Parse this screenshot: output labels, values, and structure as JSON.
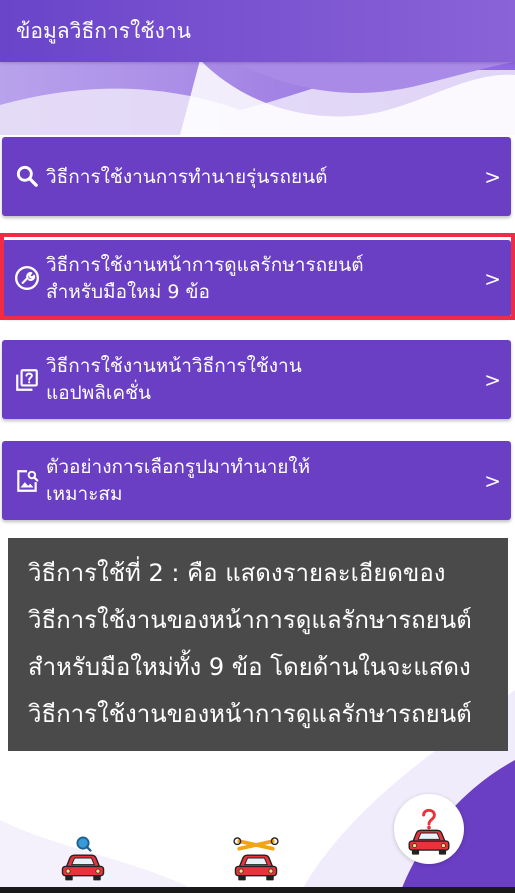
{
  "app_bar": {
    "title": "ข้อมูลวิธีการใช้งาน"
  },
  "menu": [
    {
      "line1": "วิธีการใช้งานการทำนายรุ่นรถยนต์",
      "line2": "",
      "chevron": ">",
      "icon": "search-icon"
    },
    {
      "line1": "วิธีการใช้งานหน้าการดูแลรักษารถยนต์",
      "line2": "สำหรับมือใหม่ 9 ข้อ",
      "chevron": ">",
      "icon": "wrench-circle-icon",
      "selected": true
    },
    {
      "line1": "วิธีการใช้งานหน้าวิธีการใช้งาน",
      "line2": "แอปพลิเคชั่น",
      "chevron": ">",
      "icon": "help-book-icon"
    },
    {
      "line1": "ตัวอย่างการเลือกรูปมาทำนายให้",
      "line2": "เหมาะสม",
      "chevron": ">",
      "icon": "image-search-icon"
    }
  ],
  "caption": {
    "lines": [
      "วิธีการใช้ที่ 2 : คือ แสดงรายละเอียดของ",
      "วิธีการใช้งานของหน้าการดูแลรักษารถยนต์",
      "สำหรับมือใหม่ทั้ง 9 ข้อ โดยด้านในจะแสดง",
      "วิธีการใช้งานของหน้าการดูแลรักษารถยนต์"
    ]
  },
  "bottom_nav": [
    {
      "icon": "car-search-icon"
    },
    {
      "icon": "car-wrench-icon"
    },
    {
      "icon": "car-help-icon",
      "active": true
    }
  ],
  "colors": {
    "primary": "#6a3fc4",
    "app_bar": "#7b53d1",
    "highlight": "#ef2b45",
    "caption_bg": "#4a4a4a",
    "car_red": "#e8333a",
    "help_red": "#e8333a",
    "tool_orange": "#f2a316",
    "search_blue": "#3a9ad9"
  }
}
